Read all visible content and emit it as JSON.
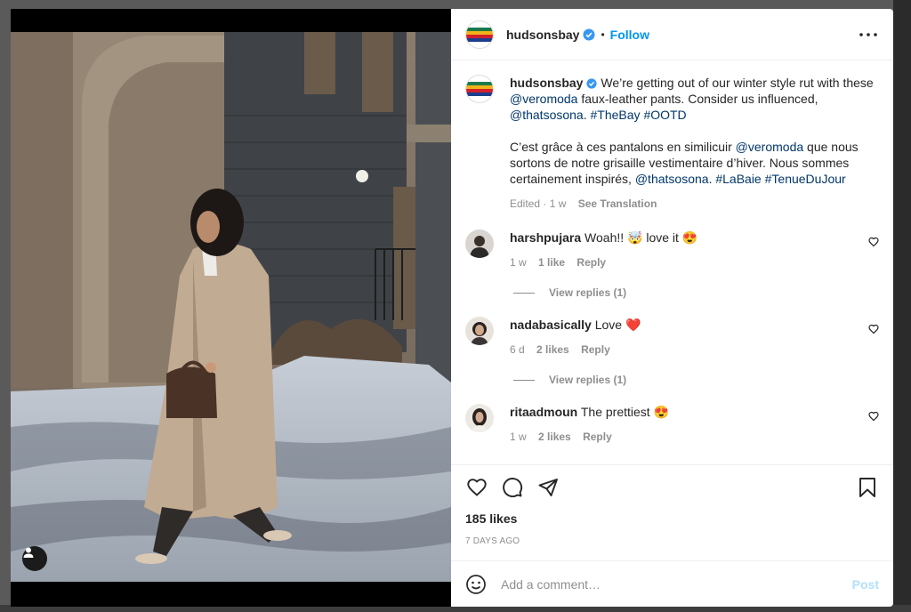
{
  "colors": {
    "link": "#00376b",
    "accent": "#0095f6",
    "verified": "#3897f0",
    "post_disabled": "#b2dffc",
    "heart_red": "#e0245e"
  },
  "header": {
    "username": "hudsonsbay",
    "separator": "•",
    "follow_label": "Follow",
    "more_icon": "more-horizontal-icon"
  },
  "caption": {
    "username": "hudsonsbay",
    "p1": {
      "t1": " We’re getting out of our winter style rut with these ",
      "m1": "@veromoda",
      "t2": " faux-leather pants. Consider us influenced, ",
      "m2": "@thatsosona",
      "t3": ". ",
      "h1": "#TheBay",
      "t4": " ",
      "h2": "#OOTD"
    },
    "p2": {
      "t1": "C’est grâce à ces pantalons en similicuir ",
      "m1": "@veromoda",
      "t2": " que nous sortons de notre grisaille vestimentaire d’hiver. Nous sommes certainement inspirés, ",
      "m2": "@thatsosona",
      "t3": ". ",
      "h1": "#LaBaie",
      "t4": " ",
      "h2": "#TenueDuJour"
    },
    "edited": "Edited · 1 w",
    "see_translation": "See Translation"
  },
  "comments": [
    {
      "username": "harshpujara",
      "text": " Woah!! 🤯 love it 😍",
      "time": "1 w",
      "likes": "1 like",
      "reply": "Reply",
      "view_replies": "View replies (1)"
    },
    {
      "username": "nadabasically",
      "text": " Love ❤️",
      "time": "6 d",
      "likes": "2 likes",
      "reply": "Reply",
      "view_replies": "View replies (1)"
    },
    {
      "username": "ritaadmoun",
      "text": " The prettiest 😍",
      "time": "1 w",
      "likes": "2 likes",
      "reply": "Reply"
    }
  ],
  "actions": {
    "like_icon": "heart-icon",
    "comment_icon": "comment-icon",
    "share_icon": "send-icon",
    "save_icon": "bookmark-icon",
    "likes": "185 likes",
    "posted": "7 DAYS AGO"
  },
  "add_comment": {
    "emoji_icon": "emoji-icon",
    "placeholder": "Add a comment…",
    "post_label": "Post"
  }
}
